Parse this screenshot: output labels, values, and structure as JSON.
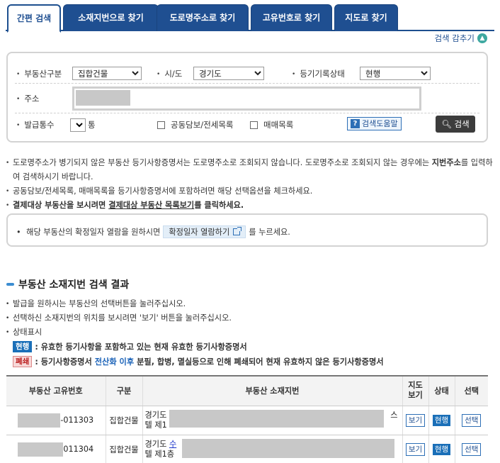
{
  "tabs": [
    {
      "label": "간편 검색",
      "active": true
    },
    {
      "label": "소재지번으로 찾기"
    },
    {
      "label": "도로명주소로 찾기"
    },
    {
      "label": "고유번호로 찾기"
    },
    {
      "label": "지도로 찾기"
    }
  ],
  "collapse_label": "검색 감추기",
  "search": {
    "property_type_label": "부동산구분",
    "property_type_value": "집합건물",
    "city_label": "시/도",
    "city_value": "경기도",
    "record_status_label": "등기기록상태",
    "record_status_value": "현행",
    "address_label": "주소",
    "copies_label": "발급통수",
    "copies_value": "1",
    "copies_unit": "통",
    "joint_collateral_label": "공동담보/전세목록",
    "sale_list_label": "매매목록",
    "help_label": "검색도움말",
    "search_button": "검색"
  },
  "notices": {
    "n1_a": "도로명주소가 병기되지 않은 부동산 등기사항증명서는 도로명주소로 조회되지 않습니다. 도로명주소로 조회되지 않는 경우에는 ",
    "n1_b": "지번주소",
    "n1_c": "를 입력하여 검색하시기 바랍니다.",
    "n2": "공동담보/전세목록, 매매목록을 등기사항증명서에 포함하려면 해당 선택옵션을 체크하세요.",
    "n3_a": "결제대상 부동산을 보시려면 ",
    "n3_link": "결제대상 부동산 목록보기",
    "n3_c": "를 클릭하세요."
  },
  "date_box": {
    "before": "해당 부동산의 확정일자 열람을 원하시면",
    "button": "확정일자 열람하기",
    "after": "를 누르세요."
  },
  "results": {
    "title": "부동산 소재지번 검색 결과",
    "note1": "발급을 원하시는 부동산의 선택버튼을 눌러주십시오.",
    "note2": "선택하신 소재지번의 위치를 보시려면 '보기' 버튼을 눌러주십시오.",
    "note3": "상태표시",
    "legend_current_badge": "현행",
    "legend_current_text": ": 유효한 등기사항을 포함하고 있는 현재 유효한 등기사항증명서",
    "legend_closed_badge": "폐쇄",
    "legend_closed_text_a": ": 등기사항증명서 ",
    "legend_closed_text_b": "전산화 이후",
    "legend_closed_text_c": " 분필, 합병, 멸실등으로 인해 폐쇄되어 현재 유효하지 않은 등기사항증명서",
    "columns": {
      "id": "부동산 고유번호",
      "type": "구분",
      "address": "부동산 소재지번",
      "map_line1": "지도",
      "map_line2": "보기",
      "status": "상태",
      "select": "선택"
    },
    "rows": [
      {
        "id_suffix": "-011303",
        "type": "집합건물",
        "addr_prefix": "경기도",
        "addr_line2_prefix": "텔 제1",
        "addr_tail": "스",
        "map": "보기",
        "status": "현행",
        "select": "선택"
      },
      {
        "id_suffix": "011304",
        "type": "집합건물",
        "addr_prefix": "경기도 ",
        "addr_link": "수",
        "addr_line2_prefix": "텔 제1층",
        "map": "보기",
        "status": "현행",
        "select": "선택"
      }
    ]
  }
}
